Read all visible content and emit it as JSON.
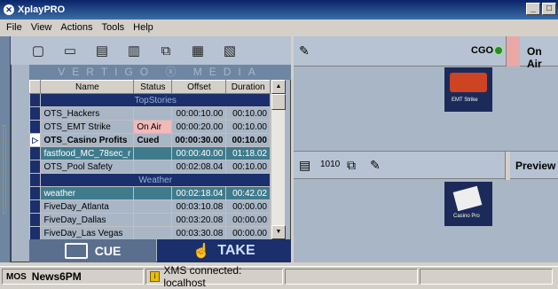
{
  "window": {
    "title": "XplayPRO"
  },
  "menu": [
    "File",
    "View",
    "Actions",
    "Tools",
    "Help"
  ],
  "banner": "VERTIGO ⓧ MEDIA",
  "table": {
    "headers": [
      "Name",
      "Status",
      "Offset",
      "Duration"
    ],
    "groups": {
      "top": "TopStories",
      "weather": "Weather"
    },
    "rows_top": [
      {
        "name": "OTS_Hackers",
        "status": "",
        "offset": "00:00:10.00",
        "duration": "00:10.00"
      },
      {
        "name": "OTS_EMT Strike",
        "status": "On Air",
        "offset": "00:00:20.00",
        "duration": "00:10.00"
      },
      {
        "name": "OTS_Casino Profits",
        "status": "Cued",
        "offset": "00:00:30.00",
        "duration": "00:10.00"
      },
      {
        "name": "fastfood_MC_78sec_r",
        "status": "",
        "offset": "00:00:40.00",
        "duration": "01:18.02"
      },
      {
        "name": "OTS_Pool Safety",
        "status": "",
        "offset": "00:02:08.04",
        "duration": "00:10.00"
      }
    ],
    "rows_weather": [
      {
        "name": "weather",
        "status": "",
        "offset": "00:02:18.04",
        "duration": "00:42.02"
      },
      {
        "name": "FiveDay_Atlanta",
        "status": "",
        "offset": "00:03:10.08",
        "duration": "00:00.00"
      },
      {
        "name": "FiveDay_Dallas",
        "status": "",
        "offset": "00:03:20.08",
        "duration": "00:00.00"
      },
      {
        "name": "FiveDay_Las Vegas",
        "status": "",
        "offset": "00:03:30.08",
        "duration": "00:00.00"
      }
    ]
  },
  "buttons": {
    "cue": "CUE",
    "take": "TAKE"
  },
  "right": {
    "cgo": "CGO",
    "on_air": "On Air",
    "preview": "Preview",
    "thumb1": "EMT Strike",
    "thumb2": "Casino Pro"
  },
  "status": {
    "mos": "MOS",
    "show": "News6PM",
    "connection": "XMS connected: localhost"
  },
  "colors": {
    "title": "#0a246a",
    "group": "#1a2f6b",
    "teal": "#3f7b8c",
    "onair": "#f4b8b8"
  }
}
